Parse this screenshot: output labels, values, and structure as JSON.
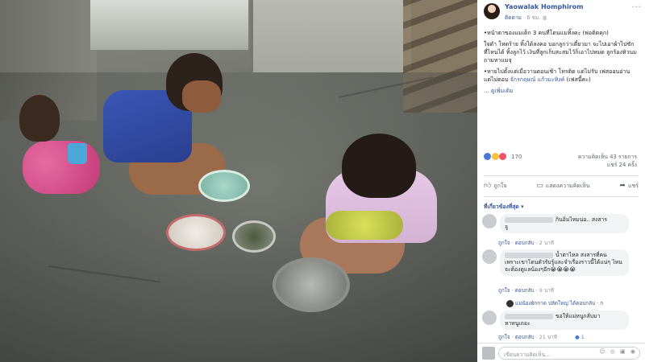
{
  "post": {
    "author": "Yaowalak Homphirom",
    "time": "6 ชม.",
    "follow": "ติดตาม",
    "menu": "···",
    "text_p1": "•หน้าตาของแมเด็ก 3 คนที่โดนแมทิ้งคะ (พ่อติดคุก)",
    "text_p2": "ใจดำ โหดร้าย ทิ้งได้ลงคอ บอกลูกว่าเดี๋ยวมา จะไปเอาผ้าไปซัก ที่ไหนได้ ทิ้งลูกไว้ เงินที่ลูกเก็บสะสมไว้ก็เอาไปหมด ลูกร้องหิวนม ถามหาแมจุ",
    "text_p3_a": "•หายไปตั้งแต่เมื่อวานตอนเช้า โทรติด แต่ไม่รับ เฟสออนอ่าน แต่ไม่ตอบ",
    "text_p3_link": "จักรกฤษณ์ แก้วมะหิงค์",
    "text_p3_b": "(เฟสนี้คะ)",
    "see_more": "... ดูเพิ่มเติม"
  },
  "reactions": {
    "count": "170",
    "comments": "ความคิดเห็น 43 รายการ",
    "shares": "แชร์ 24 ครั้ง",
    "icons": [
      "like-icon",
      "haha-icon",
      "love-icon"
    ]
  },
  "actions": {
    "like": "ถูกใจ",
    "comment": "แสดงความคิดเห็น",
    "share": "แชร์"
  },
  "filter": "ที่เกี่ยวข้องที่สุด ▾",
  "comments": [
    {
      "text": "กินอิ่มไหมน่อ.. สงสาร",
      "text2": "จู",
      "like": "ถูกใจ",
      "reply": "ตอบกลับ",
      "time": "2 นาที"
    },
    {
      "text": "น้ำตาไหล สงสารที่คน",
      "text2": "เพราะเขาโดนตัวรับรู้และจำเรื่องราวนี้ได้แน่ๆ ไหนจะต้องดูแลน้องๆอีก😭😭😭😭",
      "like": "ถูกใจ",
      "reply": "ตอบกลับ",
      "time": "9 นาที",
      "reply_line": "แม่น้องผักกาด ปลัดใหญ่ ได้ตอบกลับ · ก"
    },
    {
      "text": "ขอให้แม่หนูกลับมา",
      "text2": "หาหนูเถอะ",
      "like": "ถูกใจ",
      "reply": "ตอบกลับ",
      "time": "21 นาที",
      "likes": "1"
    }
  ],
  "composer": {
    "placeholder": "เขียนความคิดเห็น...",
    "icons": "☺ ◎ ▣ ◉"
  },
  "colors": {
    "link": "#365899",
    "meta": "#90949c",
    "bubble": "#f2f3f5"
  }
}
